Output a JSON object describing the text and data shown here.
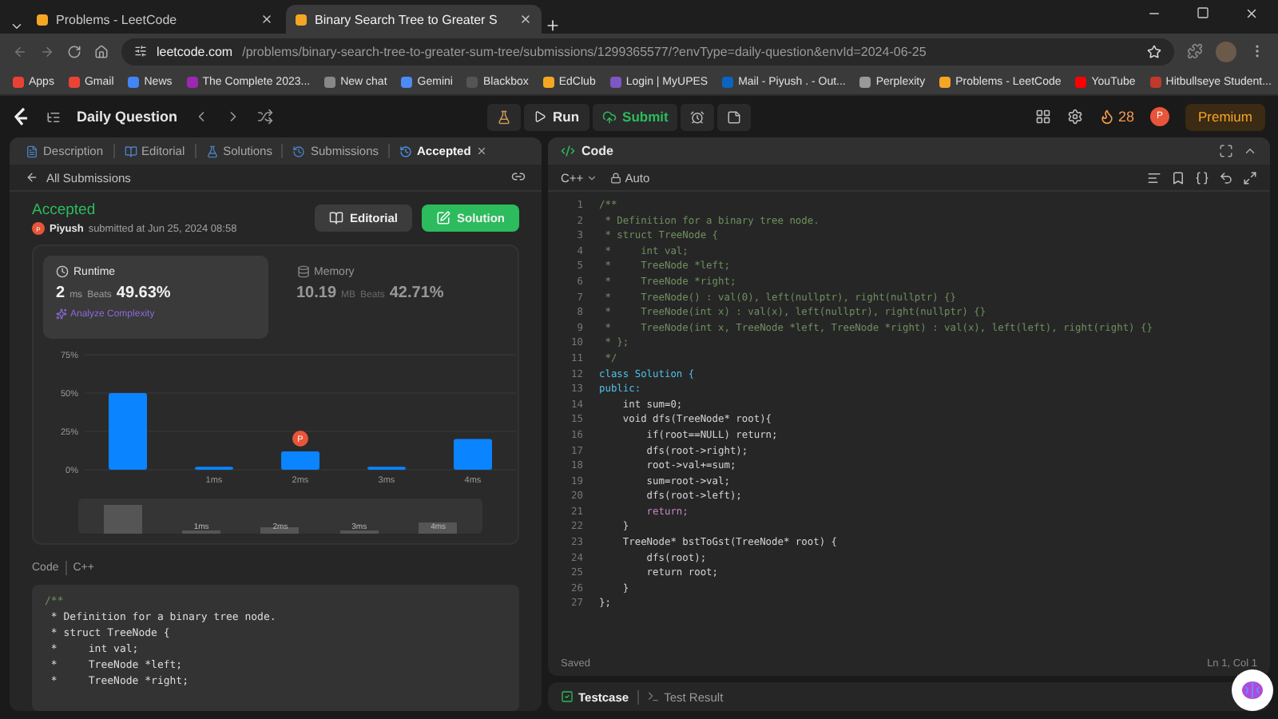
{
  "browser": {
    "tabs": [
      {
        "title": "Problems - LeetCode",
        "selected": false
      },
      {
        "title": "Binary Search Tree to Greater S",
        "selected": true
      }
    ],
    "url": {
      "host": "leetcode.com",
      "path": "/problems/binary-search-tree-to-greater-sum-tree/submissions/1299365577/?envType=daily-question&envId=2024-06-25"
    },
    "bookmarks": [
      "Apps",
      "Gmail",
      "News",
      "The Complete 2023...",
      "New chat",
      "Gemini",
      "Blackbox",
      "EdClub",
      "Login | MyUPES",
      "Mail - Piyush . - Out...",
      "Perplexity",
      "Problems - LeetCode",
      "YouTube",
      "Hitbullseye Student..."
    ]
  },
  "nav": {
    "title": "Daily Question",
    "run": "Run",
    "submit": "Submit",
    "streak": "28",
    "avatar": "P",
    "premium": "Premium"
  },
  "left": {
    "tabs": [
      {
        "label": "Description",
        "selected": false,
        "closable": false
      },
      {
        "label": "Editorial",
        "selected": false,
        "closable": false
      },
      {
        "label": "Solutions",
        "selected": false,
        "closable": false
      },
      {
        "label": "Submissions",
        "selected": false,
        "closable": false
      },
      {
        "label": "Accepted",
        "selected": true,
        "closable": true
      }
    ],
    "back": "All Submissions",
    "status": "Accepted",
    "avatar": "P",
    "user": "Piyush",
    "submitted": "submitted at Jun 25, 2024 08:58",
    "editorial": "Editorial",
    "solution": "Solution",
    "stats": [
      {
        "title": "Runtime",
        "value": "2",
        "unit": "ms",
        "beats_label": "Beats",
        "beats": "49.63%",
        "selected": true,
        "link": "Analyze Complexity"
      },
      {
        "title": "Memory",
        "value": "10.19",
        "unit": "MB",
        "beats_label": "Beats",
        "beats": "42.71%",
        "selected": false
      }
    ],
    "chart": {
      "chart_data": {
        "type": "bar",
        "x": [
          0,
          1,
          2,
          3,
          4
        ],
        "values": [
          50,
          2,
          12,
          2,
          20
        ],
        "xlim": [
          -0.5,
          4.5
        ],
        "ylim": [
          0,
          75
        ],
        "annotations": [
          {
            "x": 2,
            "text": "P"
          }
        ],
        "yticks": [
          {
            "value": 0,
            "label": "0%"
          },
          {
            "value": 25,
            "label": "25%"
          },
          {
            "value": 50,
            "label": "50%"
          },
          {
            "value": 75,
            "label": "75%"
          }
        ],
        "xticks": [
          {
            "value": 1,
            "label": "1ms"
          },
          {
            "value": 2,
            "label": "2ms"
          },
          {
            "value": 3,
            "label": "3ms"
          },
          {
            "value": 4,
            "label": "4ms"
          }
        ]
      }
    },
    "overview": [
      "1ms",
      "2ms",
      "3ms",
      "4ms"
    ],
    "code_label": "Code",
    "language": "C++",
    "code": [
      "/**",
      " * Definition for a binary tree node.",
      " * struct TreeNode {",
      " *     int val;",
      " *     TreeNode *left;",
      " *     TreeNode *right;"
    ]
  },
  "editor": {
    "title": "Code",
    "language": "C++",
    "mode": "Auto",
    "lines": [
      {
        "n": "1",
        "text": "/**",
        "kind": "comment"
      },
      {
        "n": "2",
        "text": " * Definition for a binary tree node.",
        "kind": "comment"
      },
      {
        "n": "3",
        "text": " * struct TreeNode {",
        "kind": "comment"
      },
      {
        "n": "4",
        "text": " *     int val;",
        "kind": "comment"
      },
      {
        "n": "5",
        "text": " *     TreeNode *left;",
        "kind": "comment"
      },
      {
        "n": "6",
        "text": " *     TreeNode *right;",
        "kind": "comment"
      },
      {
        "n": "7",
        "text": " *     TreeNode() : val(0), left(nullptr), right(nullptr) {}",
        "kind": "comment"
      },
      {
        "n": "8",
        "text": " *     TreeNode(int x) : val(x), left(nullptr), right(nullptr) {}",
        "kind": "comment"
      },
      {
        "n": "9",
        "text": " *     TreeNode(int x, TreeNode *left, TreeNode *right) : val(x), left(left), right(right) {}",
        "kind": "comment"
      },
      {
        "n": "10",
        "text": " * };",
        "kind": "comment"
      },
      {
        "n": "11",
        "text": " */",
        "kind": "comment"
      },
      {
        "n": "12",
        "text": "class Solution {",
        "kind": "keyword"
      },
      {
        "n": "13",
        "text": "public:",
        "kind": "keyword"
      },
      {
        "n": "14",
        "text": "    int sum=0;",
        "kind": "code"
      },
      {
        "n": "15",
        "text": "    void dfs(TreeNode* root){",
        "kind": "code"
      },
      {
        "n": "16",
        "text": "        if(root==NULL) return;",
        "kind": "code"
      },
      {
        "n": "17",
        "text": "        dfs(root->right);",
        "kind": "code"
      },
      {
        "n": "18",
        "text": "        root->val+=sum;",
        "kind": "code"
      },
      {
        "n": "19",
        "text": "        sum=root->val;",
        "kind": "code"
      },
      {
        "n": "20",
        "text": "        dfs(root->left);",
        "kind": "code"
      },
      {
        "n": "21",
        "text": "        return;",
        "kind": "control"
      },
      {
        "n": "22",
        "text": "    }",
        "kind": "code"
      },
      {
        "n": "23",
        "text": "    TreeNode* bstToGst(TreeNode* root) {",
        "kind": "code"
      },
      {
        "n": "24",
        "text": "        dfs(root);",
        "kind": "code"
      },
      {
        "n": "25",
        "text": "        return root;",
        "kind": "code"
      },
      {
        "n": "26",
        "text": "    }",
        "kind": "code"
      },
      {
        "n": "27",
        "text": "};",
        "kind": "code"
      }
    ],
    "status": "Saved",
    "cursor": "Ln 1, Col 1"
  },
  "console": {
    "tabs": [
      {
        "label": "Testcase",
        "selected": true
      },
      {
        "label": "Test Result",
        "selected": false
      }
    ]
  }
}
